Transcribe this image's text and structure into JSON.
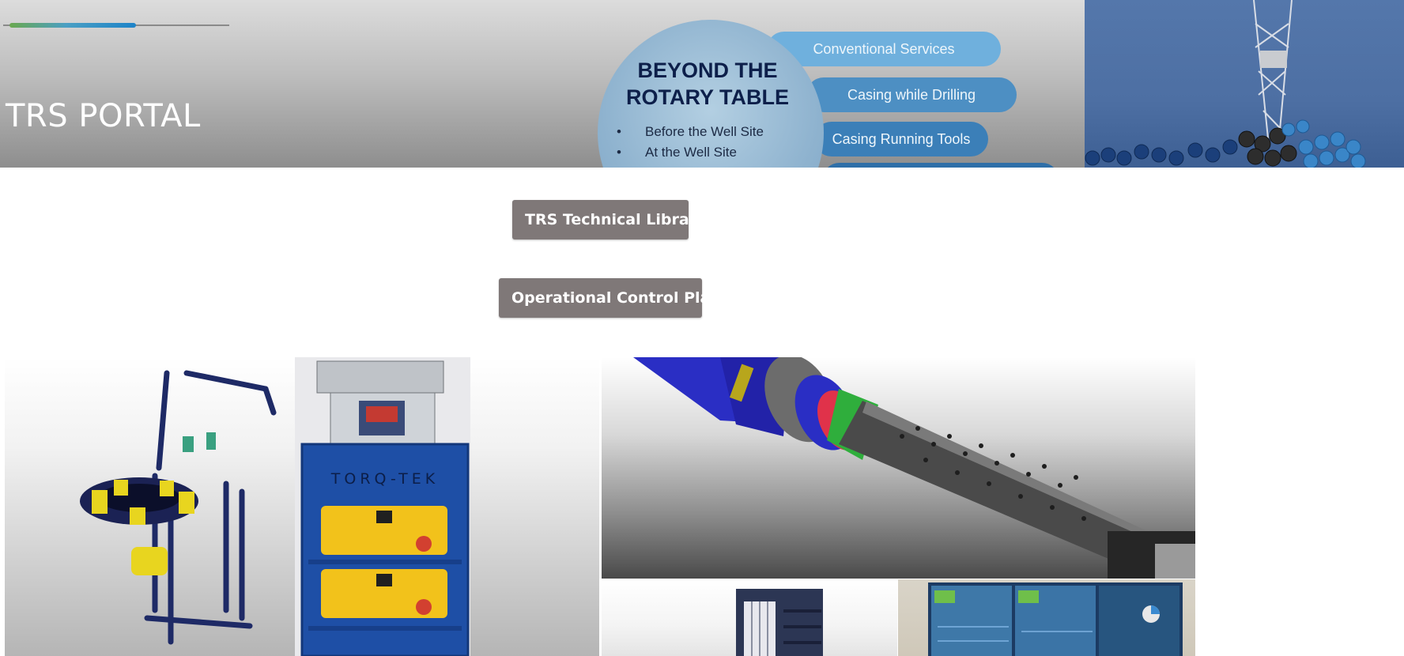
{
  "header": {
    "title": "TRS PORTAL",
    "progress_fraction": 0.56,
    "banner_graphic": {
      "heading": "BEYOND THE\nROTARY TABLE",
      "bullets": [
        "Before the Well Site",
        "At the Well Site"
      ],
      "services": [
        "Conventional Services",
        "Casing while Drilling",
        "Casing Running Tools"
      ]
    },
    "photo_icon": "drilling-rig-photo"
  },
  "buttons": {
    "technical_library": "TRS Technical Library",
    "operational_control_plan": "Operational Control Plan"
  },
  "images": [
    {
      "name": "torque-turn-equipment-photo",
      "text": "TORQ-TEK"
    },
    {
      "name": "casing-tool-render-photo"
    },
    {
      "name": "cage-equipment-photo"
    },
    {
      "name": "control-room-screens-photo"
    }
  ],
  "colors": {
    "button_bg": "#7f7878",
    "progress_start": "#6aa84f",
    "progress_end": "#1d83c8",
    "title_text": "#ffffff"
  }
}
